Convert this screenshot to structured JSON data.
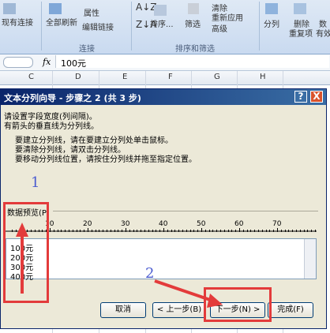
{
  "ribbon": {
    "existing_conn": "现有连接",
    "refresh_all": "全部刷新",
    "properties": "属性",
    "edit_links": "编辑链接",
    "connections_group": "连接",
    "sort": "排序...",
    "filter": "筛选",
    "clear": "清除",
    "reapply": "重新应用",
    "advanced": "高级",
    "sort_filter_group": "排序和筛选",
    "split_col": "分列",
    "remove_dup1": "删除",
    "remove_dup2": "重复项",
    "data_valid1": "数",
    "data_valid2": "有效"
  },
  "formula_bar": {
    "fx": "fx",
    "value": "100元"
  },
  "columns": [
    "C",
    "D",
    "E",
    "F",
    "G",
    "H"
  ],
  "dialog": {
    "title": "文本分列向导 - 步骤之 2 (共 3 步)",
    "help_btn": "?",
    "close_btn": "X",
    "intro1": "请设置字段宽度(列间隔)。",
    "intro2": "有箭头的垂直线为分列线。",
    "rule1": "要建立分列线，请在要建立分列处单击鼠标。",
    "rule2": "要清除分列线，请双击分列线。",
    "rule3": "要移动分列线位置，请按住分列线并拖至指定位置。",
    "preview_label": "数据预览(P)",
    "ruler_ticks": [
      "10",
      "20",
      "30",
      "40",
      "50",
      "60",
      "70"
    ],
    "preview_lines": [
      "100元",
      "200元",
      "300元",
      "400元"
    ],
    "cancel": "取消",
    "back": "< 上一步(B)",
    "next": "下一步(N) >",
    "finish": "完成(F)"
  },
  "annotations": {
    "label1": "1",
    "label2": "2"
  }
}
